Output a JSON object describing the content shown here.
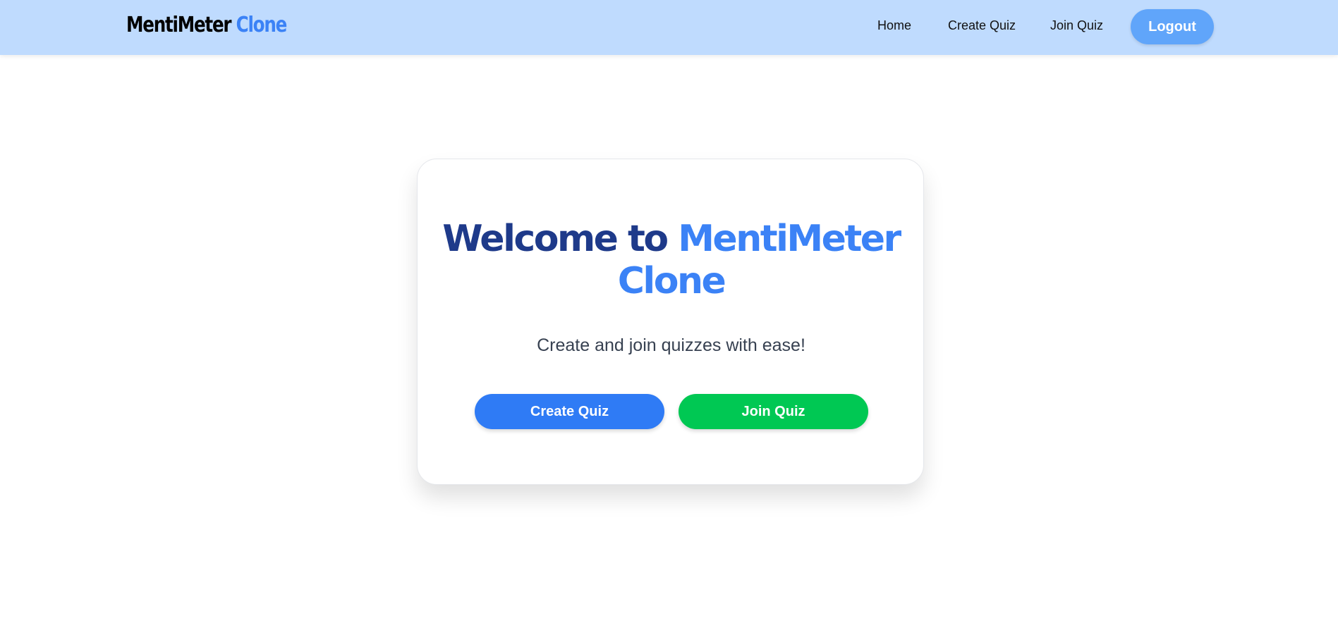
{
  "navbar": {
    "brand_primary": "MentiMeter",
    "brand_accent": "Clone",
    "links": [
      "Home",
      "Create Quiz",
      "Join Quiz"
    ],
    "logout_label": "Logout"
  },
  "hero": {
    "title_primary": "Welcome to",
    "title_accent": "MentiMeter Clone",
    "subtitle": "Create and join quizzes with ease!",
    "create_label": "Create Quiz",
    "join_label": "Join Quiz"
  },
  "colors": {
    "navbar_bg": "#bfdbfe",
    "brand_accent": "#3b82f6",
    "title_dark": "#1e3a8a",
    "create_button": "#2f7bf5",
    "join_button": "#00c853",
    "logout_button": "#60a5fa"
  }
}
